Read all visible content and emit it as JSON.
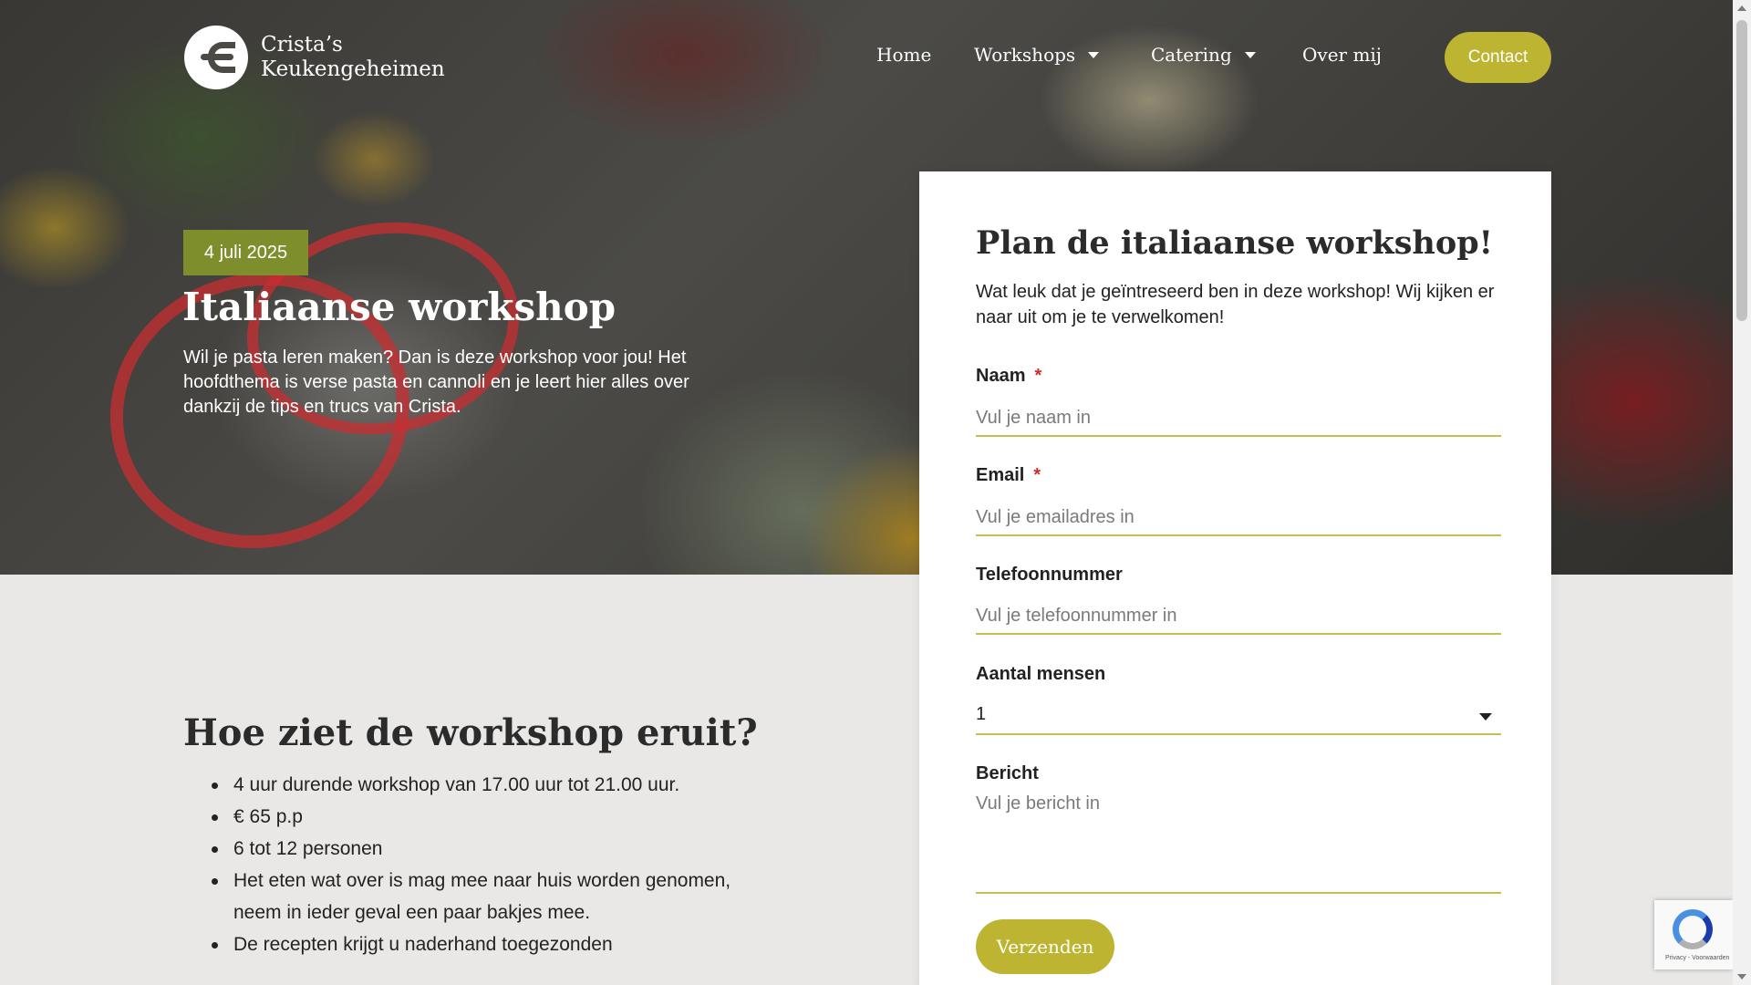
{
  "brand": {
    "line1": "Crista’s",
    "line2": "Keukengeheimen"
  },
  "nav": {
    "items": [
      {
        "label": "Home"
      },
      {
        "label": "Workshops"
      },
      {
        "label": "Catering"
      },
      {
        "label": "Over mij"
      }
    ],
    "contact_label": "Contact"
  },
  "hero": {
    "date": "4 juli 2025",
    "title": "Italiaanse workshop",
    "description": "Wil je pasta leren maken? Dan is deze workshop voor jou! Het hoofdthema is verse pasta en cannoli en je leert hier alles over dankzij de tips en trucs van Crista."
  },
  "form": {
    "title": "Plan de italiaanse workshop!",
    "intro": "Wat leuk dat je geïntreseerd ben in deze workshop! Wij kijken er naar uit om je te verwelkomen!",
    "name_label": "Naam",
    "name_placeholder": "Vul je naam in",
    "email_label": "Email",
    "email_placeholder": "Vul je emailadres in",
    "phone_label": "Telefoonnummer",
    "phone_placeholder": "Vul je telefoonnummer in",
    "people_label": "Aantal mensen",
    "people_value": "1",
    "message_label": "Bericht",
    "message_placeholder": "Vul je bericht in",
    "required_mark": "*",
    "submit_label": "Verzenden"
  },
  "details": {
    "title": "Hoe ziet de workshop eruit?",
    "items": [
      "4 uur durende workshop van 17.00 uur tot 21.00 uur.",
      "€ 65 p.p",
      "6 tot 12 personen",
      "Het eten wat over is mag mee naar huis worden genomen, neem in ieder geval een paar bakjes mee.",
      "De recepten krijgt u naderhand toegezonden"
    ]
  },
  "recaptcha": {
    "text": "Privacy - Voorwaarden"
  },
  "colors": {
    "accent": "#bdb431",
    "badge": "#7e8e2d",
    "required": "#d22a2a",
    "underline": "#c7be4f"
  }
}
